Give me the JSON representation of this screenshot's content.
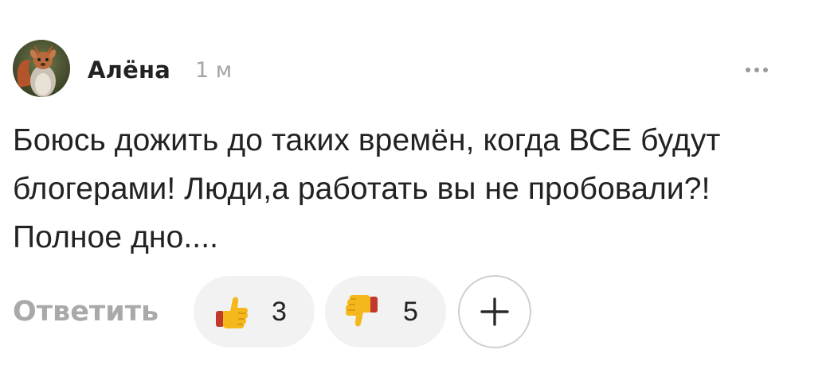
{
  "comment": {
    "author": "Алёна",
    "time": "1 м",
    "text": "Боюсь дожить до таких времён, когда ВСЕ будут блогерами! Люди,а работать вы не пробовали?! Полное дно....",
    "avatar_icon": "squirrel-avatar",
    "more_icon": "more-dots-icon"
  },
  "actions": {
    "reply_label": "Ответить",
    "reactions": [
      {
        "icon": "thumbs-up-emoji",
        "count": "3"
      },
      {
        "icon": "thumbs-down-emoji",
        "count": "5"
      }
    ],
    "add_reaction_icon": "plus-icon"
  },
  "colors": {
    "text": "#222222",
    "muted": "#a3a3a3",
    "pill_bg": "#f2f2f2",
    "border": "#cfcfcf"
  }
}
